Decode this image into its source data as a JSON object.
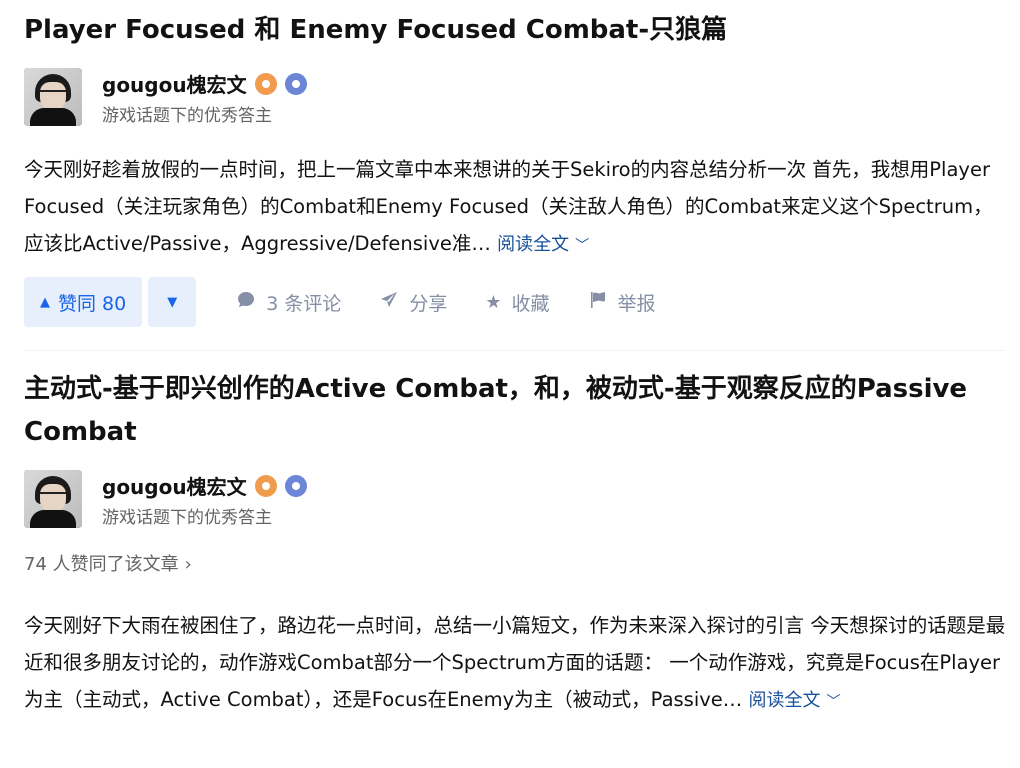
{
  "articles": [
    {
      "title": "Player Focused 和 Enemy Focused Combat-只狼篇",
      "author": {
        "name": "gougou槐宏文",
        "description": "游戏话题下的优秀答主"
      },
      "excerpt": "今天刚好趁着放假的一点时间，把上一篇文章中本来想讲的关于Sekiro的内容总结分析一次 首先，我想用Player Focused（关注玩家角色）的Combat和Enemy Focused（关注敌人角色）的Combat来定义这个Spectrum，应该比Active/Passive，Aggressive/Defensive准…",
      "read_more": "阅读全文",
      "actions": {
        "vote_up": "赞同 80",
        "comments": "3 条评论",
        "share": "分享",
        "favorite": "收藏",
        "report": "举报"
      }
    },
    {
      "title": "主动式-基于即兴创作的Active Combat，和，被动式-基于观察反应的Passive Combat",
      "author": {
        "name": "gougou槐宏文",
        "description": "游戏话题下的优秀答主"
      },
      "likes_summary": "74 人赞同了该文章",
      "excerpt": "今天刚好下大雨在被困住了，路边花一点时间，总结一小篇短文，作为未来深入探讨的引言 今天想探讨的话题是最近和很多朋友讨论的，动作游戏Combat部分一个Spectrum方面的话题： 一个动作游戏，究竟是Focus在Player为主（主动式，Active Combat），还是Focus在Enemy为主（被动式，Passive…",
      "read_more": "阅读全文"
    }
  ],
  "icons": {
    "vote_up": "triangle-up-icon",
    "vote_down": "triangle-down-icon",
    "comment": "comment-bubble-icon",
    "share": "paper-plane-icon",
    "favorite": "star-icon",
    "report": "flag-icon",
    "chevron": "chevron-down-icon",
    "badge_orange": "excellent-answerer-badge-icon",
    "badge_blue": "verified-badge-icon"
  },
  "colors": {
    "link": "#175199",
    "vote_bg": "#e7eefc",
    "vote_text": "#1766e8",
    "muted": "#8590a6",
    "badge_orange": "#f09b4d",
    "badge_blue": "#6c85d6"
  }
}
